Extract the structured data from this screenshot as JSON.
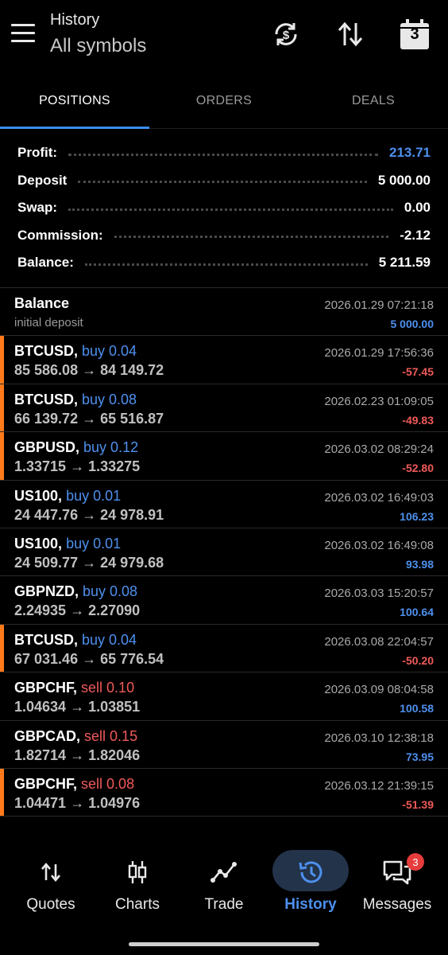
{
  "header": {
    "title": "History",
    "subtitle": "All symbols",
    "calendar_day": "3"
  },
  "tabs": [
    {
      "label": "POSITIONS",
      "active": true
    },
    {
      "label": "ORDERS",
      "active": false
    },
    {
      "label": "DEALS",
      "active": false
    }
  ],
  "summary": [
    {
      "label": "Profit:",
      "value": "213.71"
    },
    {
      "label": "Deposit",
      "value": "5 000.00"
    },
    {
      "label": "Swap:",
      "value": "0.00"
    },
    {
      "label": "Commission:",
      "value": "-2.12"
    },
    {
      "label": "Balance:",
      "value": "5 211.59"
    }
  ],
  "balance_entry": {
    "title": "Balance",
    "subtitle": "initial deposit",
    "date": "2026.01.29 07:21:18",
    "amount": "5 000.00"
  },
  "deals": [
    {
      "symbol": "BTCUSD,",
      "direction": "buy 0.04",
      "prices": "85 586.08 → 84 149.72",
      "date": "2026.01.29 17:56:36",
      "profit": "-57.45"
    },
    {
      "symbol": "BTCUSD,",
      "direction": "buy 0.08",
      "prices": "66 139.72 → 65 516.87",
      "date": "2026.02.23 01:09:05",
      "profit": "-49.83"
    },
    {
      "symbol": "GBPUSD,",
      "direction": "buy 0.12",
      "prices": "1.33715 → 1.33275",
      "date": "2026.03.02 08:29:24",
      "profit": "-52.80"
    },
    {
      "symbol": "US100,",
      "direction": "buy 0.01",
      "prices": "24 447.76 → 24 978.91",
      "date": "2026.03.02 16:49:03",
      "profit": "106.23"
    },
    {
      "symbol": "US100,",
      "direction": "buy 0.01",
      "prices": "24 509.77 → 24 979.68",
      "date": "2026.03.02 16:49:08",
      "profit": "93.98"
    },
    {
      "symbol": "GBPNZD,",
      "direction": "buy 0.08",
      "prices": "2.24935 → 2.27090",
      "date": "2026.03.03 15:20:57",
      "profit": "100.64"
    },
    {
      "symbol": "BTCUSD,",
      "direction": "buy 0.04",
      "prices": "67 031.46 → 65 776.54",
      "date": "2026.03.08 22:04:57",
      "profit": "-50.20"
    },
    {
      "symbol": "GBPCHF,",
      "direction": "sell 0.10",
      "prices": "1.04634 → 1.03851",
      "date": "2026.03.09 08:04:58",
      "profit": "100.58"
    },
    {
      "symbol": "GBPCAD,",
      "direction": "sell 0.15",
      "prices": "1.82714 → 1.82046",
      "date": "2026.03.10 12:38:18",
      "profit": "73.95"
    },
    {
      "symbol": "GBPCHF,",
      "direction": "sell 0.08",
      "prices": "1.04471 → 1.04976",
      "date": "2026.03.12 21:39:15",
      "profit": "-51.39"
    }
  ],
  "bottom_nav": [
    {
      "label": "Quotes",
      "icon": "arrows-updown-icon"
    },
    {
      "label": "Charts",
      "icon": "candlestick-icon"
    },
    {
      "label": "Trade",
      "icon": "trend-line-icon"
    },
    {
      "label": "History",
      "icon": "history-clock-icon",
      "active": true
    },
    {
      "label": "Messages",
      "icon": "chat-bubbles-icon",
      "badge": "3"
    }
  ],
  "colors": {
    "accent": "#4d90ee",
    "loss": "#f05a5a",
    "loss_bar": "#ff7a1a",
    "background": "#000000"
  }
}
